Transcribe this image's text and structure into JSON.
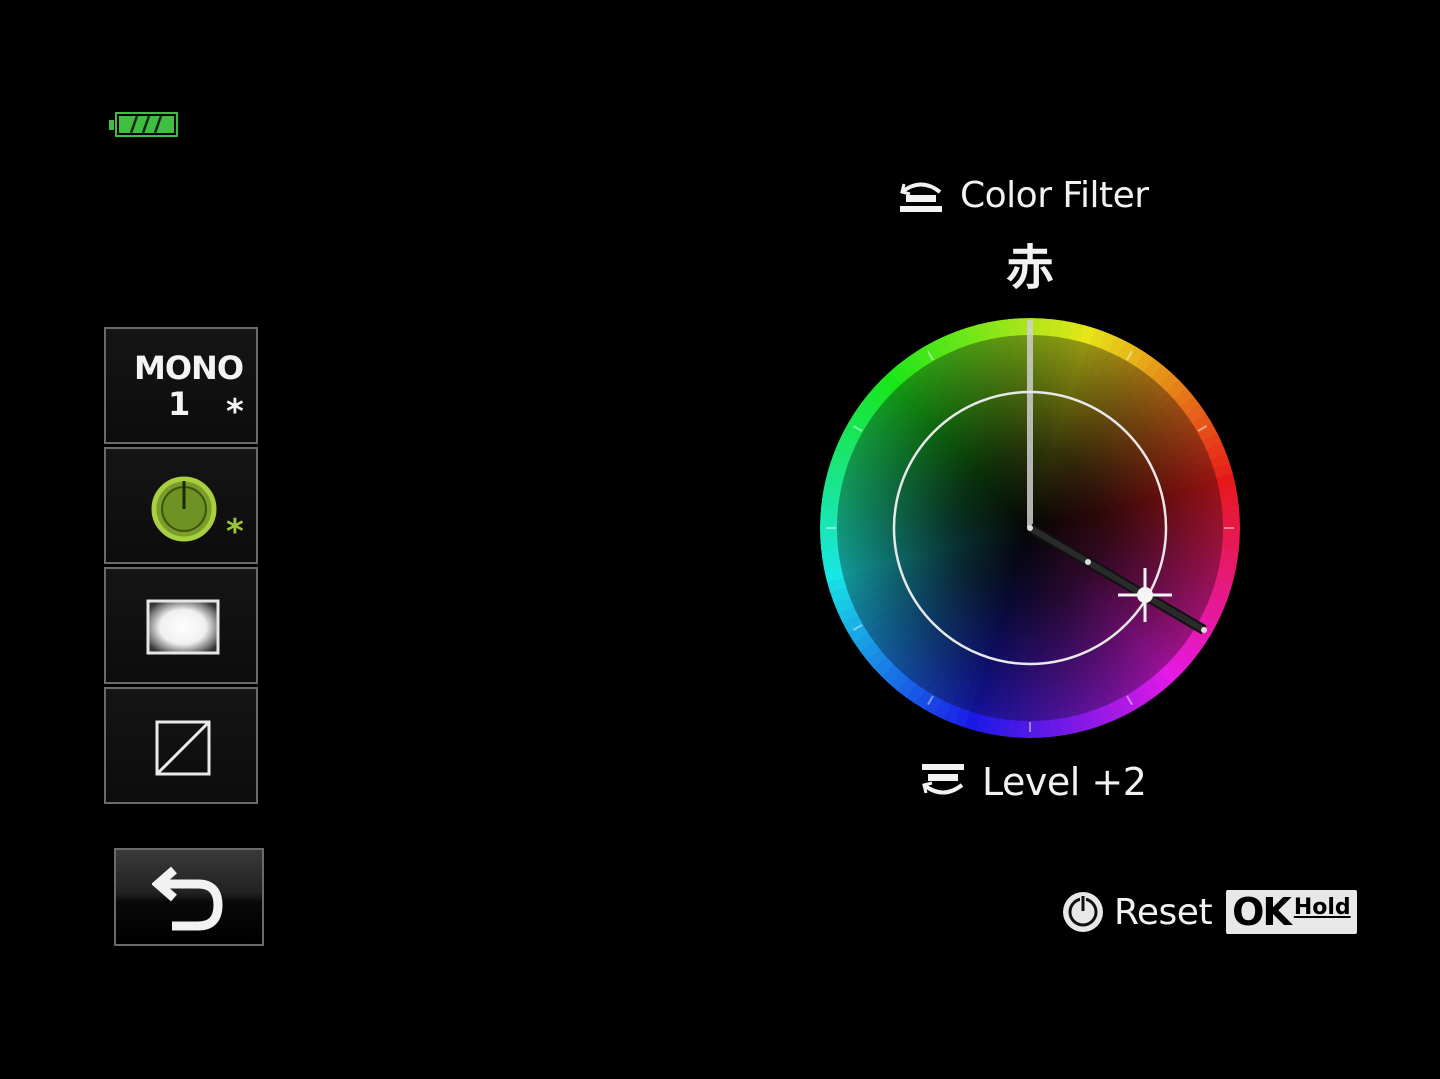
{
  "status": {
    "battery_level": 1.0,
    "battery_color": "#3fbf3f"
  },
  "left_panel": {
    "mono": {
      "label": "MONO",
      "number": "1",
      "star": "*"
    },
    "color_filter_btn": {
      "star": "*",
      "accent": "#9bc43a"
    },
    "vignette_btn": {},
    "tone_btn": {},
    "back_button": {
      "icon": "return-arrow-icon"
    }
  },
  "color_filter": {
    "title": "Color Filter",
    "title_icon": "front-dial-icon",
    "value": "赤",
    "level_label": "Level +2",
    "level_icon": "rear-dial-icon",
    "hue_selection": "red",
    "level": 2
  },
  "footer": {
    "reset_label": "Reset",
    "reset_icon": "power-icon",
    "ok_label": "OK",
    "hold_label": "Hold"
  }
}
